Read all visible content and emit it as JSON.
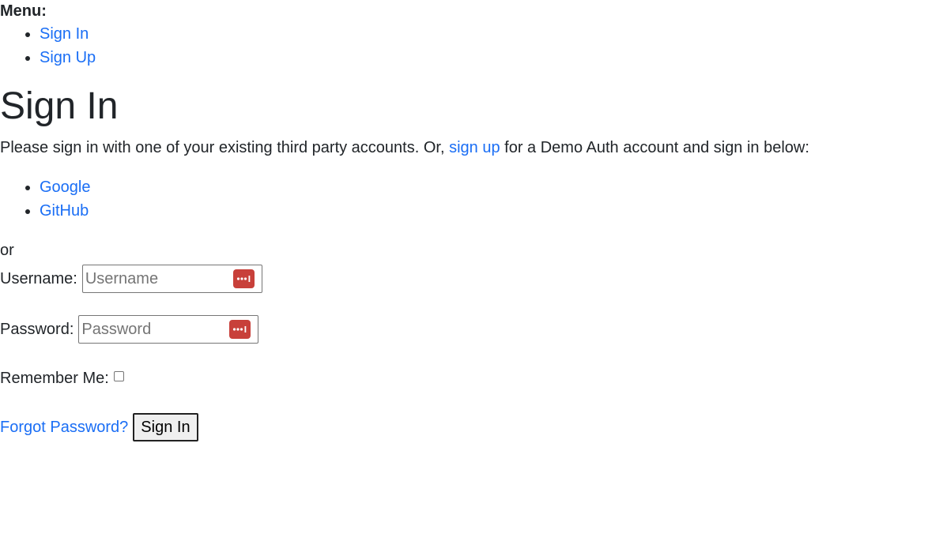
{
  "menu": {
    "heading": "Menu:",
    "items": [
      {
        "label": "Sign In"
      },
      {
        "label": "Sign Up"
      }
    ]
  },
  "page_title": "Sign In",
  "intro": {
    "before": "Please sign in with one of your existing third party accounts. Or, ",
    "link": "sign up",
    "after": " for a Demo Auth account and sign in below:"
  },
  "providers": [
    {
      "label": "Google"
    },
    {
      "label": "GitHub"
    }
  ],
  "or_text": "or",
  "form": {
    "username_label": "Username:",
    "username_placeholder": "Username",
    "username_value": "",
    "password_label": "Password:",
    "password_placeholder": "Password",
    "password_value": "",
    "remember_label": "Remember Me:",
    "remember_checked": false,
    "forgot_link": "Forgot Password?",
    "submit_label": "Sign In"
  },
  "icons": {
    "password_manager": "password-manager-icon"
  },
  "colors": {
    "link": "#1a6ef5",
    "text": "#212529",
    "password_manager_icon": "#c8403a"
  }
}
